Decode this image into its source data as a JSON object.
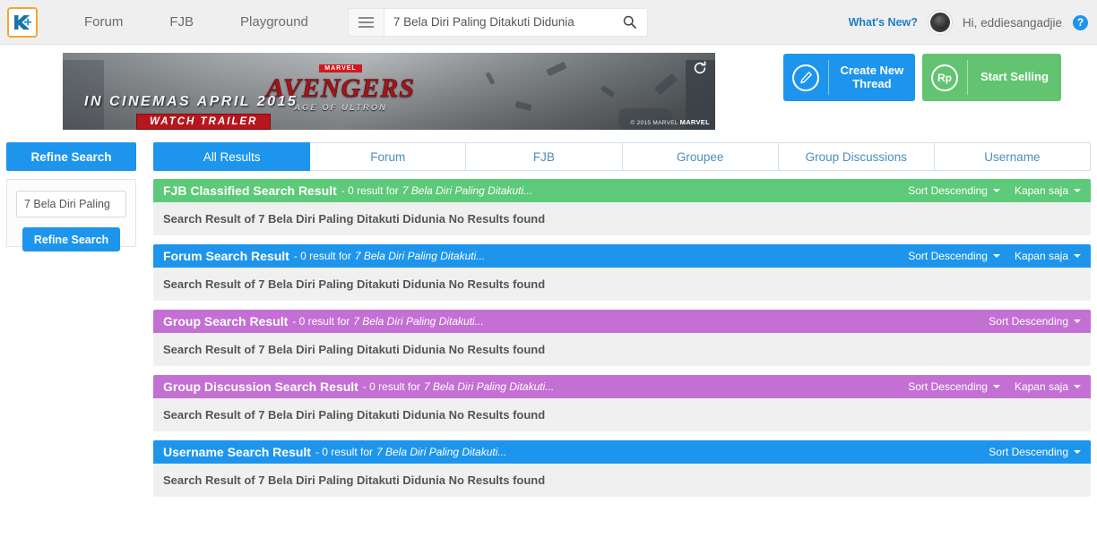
{
  "navbar": {
    "logo_alt": "kaskus-logo",
    "links": [
      {
        "label": "Forum"
      },
      {
        "label": "FJB"
      },
      {
        "label": "Playground"
      }
    ],
    "search": {
      "value": "7 Bela Diri Paling Ditakuti Didunia",
      "placeholder": "Search"
    },
    "whats_new": "What's New?",
    "greeting": "Hi, eddiesangadjie",
    "help": "?"
  },
  "banner": {
    "marvel_tag": "MARVEL",
    "title": "AVENGERS",
    "subtitle": "AGE OF ULTRON",
    "tagline": "IN CINEMAS APRIL 2015",
    "cta": "WATCH TRAILER",
    "credit_prefix": "© 2015 MARVEL ",
    "credit_brand": "MARVEL"
  },
  "actions": [
    {
      "icon": "pencil-icon",
      "label": "Create New Thread",
      "color": "#1e95ec"
    },
    {
      "icon": "rupiah-icon",
      "label": "Start Selling",
      "color": "#62c471"
    }
  ],
  "refine": {
    "tab_label": "Refine Search",
    "input_value": "7 Bela Diri Paling",
    "button_label": "Refine Search"
  },
  "tabs": [
    {
      "label": "All Results",
      "active": true
    },
    {
      "label": "Forum",
      "active": false
    },
    {
      "label": "FJB",
      "active": false
    },
    {
      "label": "Groupee",
      "active": false
    },
    {
      "label": "Group Discussions",
      "active": false
    },
    {
      "label": "Username",
      "active": false
    }
  ],
  "colors": {
    "green": "#5cca78",
    "blue": "#1e95ec",
    "purple": "#c46fd4",
    "body_bg": "#f0f0f0",
    "navbar_bg": "#efefef",
    "accent_orange": "#f0a830"
  },
  "results": [
    {
      "title": "FJB Classified Search Result",
      "count_text": "- 0 result for",
      "query": "7 Bela Diri Paling Ditakuti...",
      "color": "#5cca78",
      "sort_label": "Sort Descending",
      "time_label": "Kapan saja",
      "has_time_filter": true,
      "body": "Search Result of 7 Bela Diri Paling Ditakuti Didunia No Results found"
    },
    {
      "title": "Forum Search Result",
      "count_text": "- 0 result for",
      "query": "7 Bela Diri Paling Ditakuti...",
      "color": "#1e95ec",
      "sort_label": "Sort Descending",
      "time_label": "Kapan saja",
      "has_time_filter": true,
      "body": "Search Result of 7 Bela Diri Paling Ditakuti Didunia No Results found"
    },
    {
      "title": "Group Search Result",
      "count_text": "- 0 result for",
      "query": "7 Bela Diri Paling Ditakuti...",
      "color": "#c46fd4",
      "sort_label": "Sort Descending",
      "time_label": "",
      "has_time_filter": false,
      "body": "Search Result of 7 Bela Diri Paling Ditakuti Didunia No Results found"
    },
    {
      "title": "Group Discussion Search Result",
      "count_text": "- 0 result for",
      "query": "7 Bela Diri Paling Ditakuti...",
      "color": "#c46fd4",
      "sort_label": "Sort Descending",
      "time_label": "Kapan saja",
      "has_time_filter": true,
      "body": "Search Result of 7 Bela Diri Paling Ditakuti Didunia No Results found"
    },
    {
      "title": "Username Search Result",
      "count_text": "- 0 result for",
      "query": "7 Bela Diri Paling Ditakuti...",
      "color": "#1e95ec",
      "sort_label": "Sort Descending",
      "time_label": "",
      "has_time_filter": false,
      "body": "Search Result of 7 Bela Diri Paling Ditakuti Didunia No Results found"
    }
  ]
}
